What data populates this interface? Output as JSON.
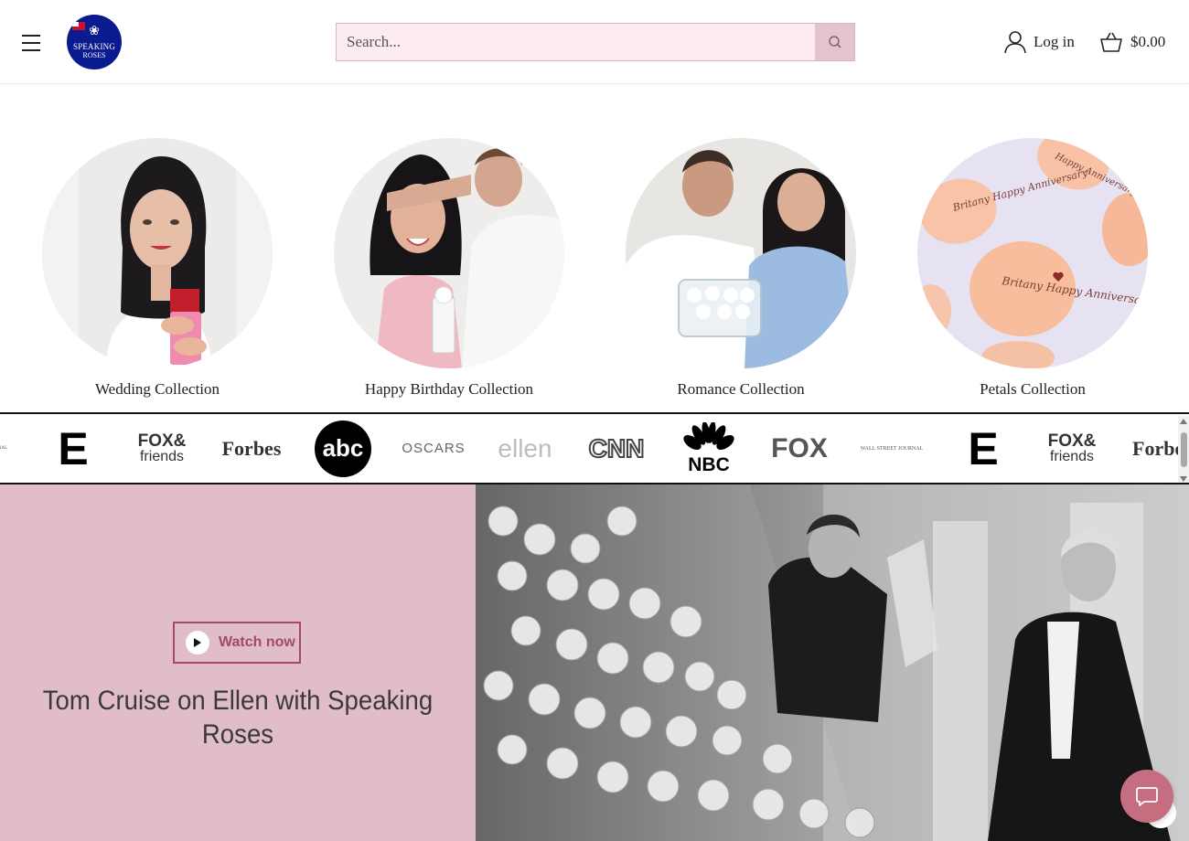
{
  "header": {
    "menu_icon": "hamburger-menu-icon",
    "logo": {
      "line1": "SPEAKING",
      "line2": "ROSES"
    },
    "search": {
      "placeholder": "Search...",
      "icon": "search-icon"
    },
    "login_label": "Log in",
    "cart_total": "$0.00"
  },
  "collections": [
    {
      "title": "Wedding Collection"
    },
    {
      "title": "Happy Birthday Collection"
    },
    {
      "title": "Romance Collection"
    },
    {
      "title": "Petals Collection"
    }
  ],
  "petals": {
    "text1": "Britany Happy Anniversary",
    "text2": "Britany Happy Anniversary",
    "text3": "Happy Anniversary"
  },
  "press_logos": [
    {
      "name": "E!",
      "text": "E"
    },
    {
      "name": "Fox & Friends",
      "text1": "FOX&",
      "text2": "friends"
    },
    {
      "name": "Forbes",
      "text": "Forbes"
    },
    {
      "name": "abc",
      "text": "abc"
    },
    {
      "name": "Oscars",
      "text": "OSCARS"
    },
    {
      "name": "ellen",
      "text": "ellen"
    },
    {
      "name": "CNN",
      "text": "CNN"
    },
    {
      "name": "NBC",
      "text": "NBC"
    },
    {
      "name": "FOX",
      "text": "FOX"
    },
    {
      "name": "Wall Street Journal",
      "text": "WALL STREET JOURNAL"
    },
    {
      "name": "E!",
      "text": "E"
    },
    {
      "name": "Fox & Friends",
      "text1": "FOX&",
      "text2": "friends"
    },
    {
      "name": "Forbes",
      "text": "Forbes"
    }
  ],
  "promo": {
    "watch_label": "Watch now",
    "headline": "Tom Cruise on Ellen with Speaking Roses"
  },
  "colors": {
    "accent": "#a34a6a",
    "promo_bg": "#e0bdc8",
    "search_bg": "#fcebf0",
    "logo_bg": "#0a1a8f",
    "chat": "#c46e80"
  }
}
